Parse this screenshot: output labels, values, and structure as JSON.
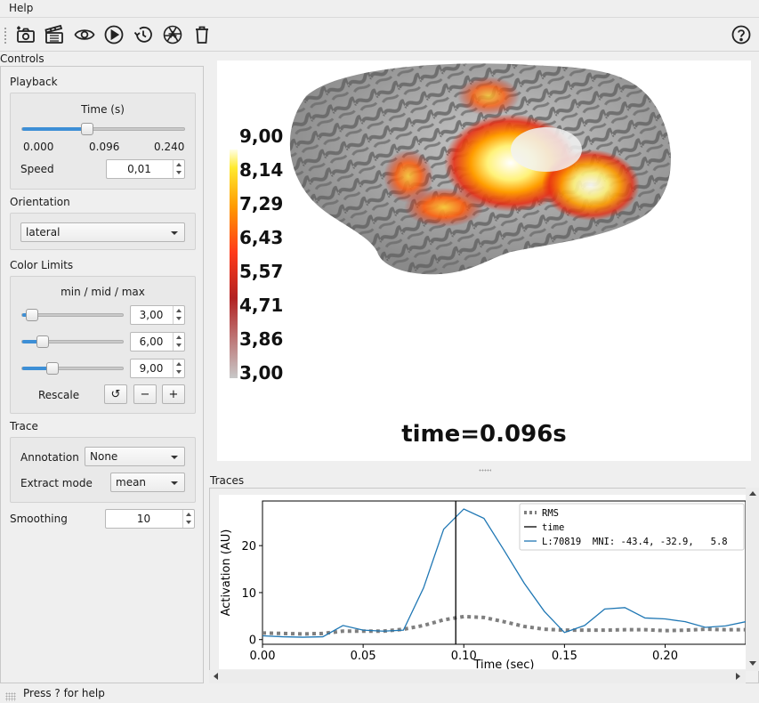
{
  "menubar": {
    "help_label": "Help"
  },
  "toolbar": {
    "icons": [
      "screenshot-icon",
      "movie-icon",
      "visibility-icon",
      "play-icon",
      "reset-icon",
      "shutter-icon",
      "clear-icon",
      "help-icon"
    ]
  },
  "controls": {
    "title": "Controls",
    "playback": {
      "title": "Playback",
      "time_label": "Time (s)",
      "time_fraction": 0.4,
      "ticks": [
        "0.000",
        "0.096",
        "0.240"
      ],
      "speed_label": "Speed",
      "speed_value": "0,01"
    },
    "orientation": {
      "title": "Orientation",
      "value": "lateral"
    },
    "color_limits": {
      "title": "Color Limits",
      "header": "min / mid / max",
      "min_value": "3,00",
      "mid_value": "6,00",
      "max_value": "9,00",
      "min_fraction": 0.1,
      "mid_fraction": 0.2,
      "max_fraction": 0.3,
      "rescale_label": "Rescale",
      "reset_glyph": "↺",
      "minus_glyph": "−",
      "plus_glyph": "+"
    },
    "trace": {
      "title": "Trace",
      "annotation_label": "Annotation",
      "annotation_value": "None",
      "extract_label": "Extract mode",
      "extract_value": "mean"
    },
    "smoothing": {
      "label": "Smoothing",
      "value": "10"
    }
  },
  "view3d": {
    "time_text": "time=0.096s",
    "colorbar_ticks": [
      "9,00",
      "8,14",
      "7,29",
      "6,43",
      "5,57",
      "4,71",
      "3,86",
      "3,00"
    ]
  },
  "traces": {
    "title": "Traces"
  },
  "status": {
    "text": "Press ? for help"
  },
  "chart_data": {
    "type": "line",
    "xlabel": "Time (sec)",
    "ylabel": "Activation (AU)",
    "xlim": [
      0.0,
      0.24
    ],
    "ylim": [
      -1,
      29.5
    ],
    "xticks": [
      "0.00",
      "0.05",
      "0.10",
      "0.15",
      "0.20"
    ],
    "yticks": [
      "0",
      "10",
      "20"
    ],
    "legend_position": "top-right",
    "time_marker": 0.096,
    "series": [
      {
        "name": "RMS",
        "style": "dotted",
        "color": "#7f7f7f",
        "x": [
          0.0,
          0.01,
          0.02,
          0.03,
          0.04,
          0.05,
          0.06,
          0.07,
          0.08,
          0.09,
          0.1,
          0.11,
          0.12,
          0.13,
          0.14,
          0.15,
          0.16,
          0.17,
          0.18,
          0.19,
          0.2,
          0.21,
          0.22,
          0.23,
          0.24
        ],
        "values": [
          1.4,
          1.3,
          1.2,
          1.3,
          1.8,
          1.8,
          1.8,
          2.2,
          3.0,
          4.2,
          4.9,
          4.7,
          3.8,
          2.8,
          2.2,
          2.0,
          2.0,
          2.0,
          2.1,
          2.1,
          1.9,
          2.0,
          2.2,
          2.1,
          2.1
        ]
      },
      {
        "name": "time",
        "style": "solid",
        "color": "#000000"
      },
      {
        "name": "L:70819  MNI: -43.4, -32.9,   5.8",
        "style": "solid",
        "color": "#1f77b4",
        "x": [
          0.0,
          0.01,
          0.02,
          0.03,
          0.04,
          0.05,
          0.06,
          0.07,
          0.08,
          0.09,
          0.1,
          0.11,
          0.12,
          0.13,
          0.14,
          0.15,
          0.16,
          0.17,
          0.18,
          0.19,
          0.2,
          0.21,
          0.22,
          0.23,
          0.24
        ],
        "values": [
          0.8,
          0.6,
          0.5,
          0.6,
          3.0,
          2.0,
          1.8,
          2.0,
          11.0,
          23.5,
          27.8,
          25.8,
          19.0,
          12.0,
          6.0,
          1.5,
          3.0,
          6.5,
          6.8,
          4.6,
          4.4,
          3.8,
          2.6,
          2.9,
          3.8
        ]
      }
    ]
  }
}
